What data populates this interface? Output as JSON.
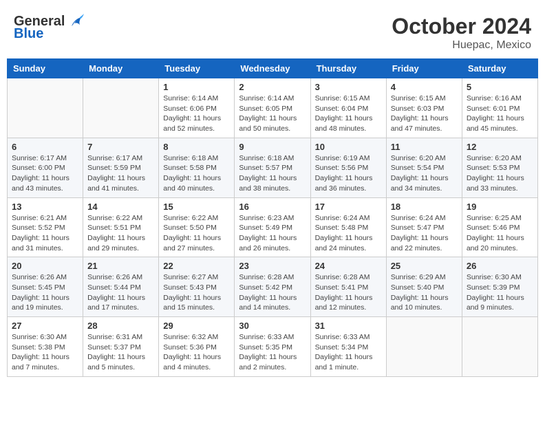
{
  "header": {
    "logo_general": "General",
    "logo_blue": "Blue",
    "month_title": "October 2024",
    "location": "Huepac, Mexico"
  },
  "days_of_week": [
    "Sunday",
    "Monday",
    "Tuesday",
    "Wednesday",
    "Thursday",
    "Friday",
    "Saturday"
  ],
  "weeks": [
    [
      {
        "day": "",
        "info": ""
      },
      {
        "day": "",
        "info": ""
      },
      {
        "day": "1",
        "info": "Sunrise: 6:14 AM\nSunset: 6:06 PM\nDaylight: 11 hours and 52 minutes."
      },
      {
        "day": "2",
        "info": "Sunrise: 6:14 AM\nSunset: 6:05 PM\nDaylight: 11 hours and 50 minutes."
      },
      {
        "day": "3",
        "info": "Sunrise: 6:15 AM\nSunset: 6:04 PM\nDaylight: 11 hours and 48 minutes."
      },
      {
        "day": "4",
        "info": "Sunrise: 6:15 AM\nSunset: 6:03 PM\nDaylight: 11 hours and 47 minutes."
      },
      {
        "day": "5",
        "info": "Sunrise: 6:16 AM\nSunset: 6:01 PM\nDaylight: 11 hours and 45 minutes."
      }
    ],
    [
      {
        "day": "6",
        "info": "Sunrise: 6:17 AM\nSunset: 6:00 PM\nDaylight: 11 hours and 43 minutes."
      },
      {
        "day": "7",
        "info": "Sunrise: 6:17 AM\nSunset: 5:59 PM\nDaylight: 11 hours and 41 minutes."
      },
      {
        "day": "8",
        "info": "Sunrise: 6:18 AM\nSunset: 5:58 PM\nDaylight: 11 hours and 40 minutes."
      },
      {
        "day": "9",
        "info": "Sunrise: 6:18 AM\nSunset: 5:57 PM\nDaylight: 11 hours and 38 minutes."
      },
      {
        "day": "10",
        "info": "Sunrise: 6:19 AM\nSunset: 5:56 PM\nDaylight: 11 hours and 36 minutes."
      },
      {
        "day": "11",
        "info": "Sunrise: 6:20 AM\nSunset: 5:54 PM\nDaylight: 11 hours and 34 minutes."
      },
      {
        "day": "12",
        "info": "Sunrise: 6:20 AM\nSunset: 5:53 PM\nDaylight: 11 hours and 33 minutes."
      }
    ],
    [
      {
        "day": "13",
        "info": "Sunrise: 6:21 AM\nSunset: 5:52 PM\nDaylight: 11 hours and 31 minutes."
      },
      {
        "day": "14",
        "info": "Sunrise: 6:22 AM\nSunset: 5:51 PM\nDaylight: 11 hours and 29 minutes."
      },
      {
        "day": "15",
        "info": "Sunrise: 6:22 AM\nSunset: 5:50 PM\nDaylight: 11 hours and 27 minutes."
      },
      {
        "day": "16",
        "info": "Sunrise: 6:23 AM\nSunset: 5:49 PM\nDaylight: 11 hours and 26 minutes."
      },
      {
        "day": "17",
        "info": "Sunrise: 6:24 AM\nSunset: 5:48 PM\nDaylight: 11 hours and 24 minutes."
      },
      {
        "day": "18",
        "info": "Sunrise: 6:24 AM\nSunset: 5:47 PM\nDaylight: 11 hours and 22 minutes."
      },
      {
        "day": "19",
        "info": "Sunrise: 6:25 AM\nSunset: 5:46 PM\nDaylight: 11 hours and 20 minutes."
      }
    ],
    [
      {
        "day": "20",
        "info": "Sunrise: 6:26 AM\nSunset: 5:45 PM\nDaylight: 11 hours and 19 minutes."
      },
      {
        "day": "21",
        "info": "Sunrise: 6:26 AM\nSunset: 5:44 PM\nDaylight: 11 hours and 17 minutes."
      },
      {
        "day": "22",
        "info": "Sunrise: 6:27 AM\nSunset: 5:43 PM\nDaylight: 11 hours and 15 minutes."
      },
      {
        "day": "23",
        "info": "Sunrise: 6:28 AM\nSunset: 5:42 PM\nDaylight: 11 hours and 14 minutes."
      },
      {
        "day": "24",
        "info": "Sunrise: 6:28 AM\nSunset: 5:41 PM\nDaylight: 11 hours and 12 minutes."
      },
      {
        "day": "25",
        "info": "Sunrise: 6:29 AM\nSunset: 5:40 PM\nDaylight: 11 hours and 10 minutes."
      },
      {
        "day": "26",
        "info": "Sunrise: 6:30 AM\nSunset: 5:39 PM\nDaylight: 11 hours and 9 minutes."
      }
    ],
    [
      {
        "day": "27",
        "info": "Sunrise: 6:30 AM\nSunset: 5:38 PM\nDaylight: 11 hours and 7 minutes."
      },
      {
        "day": "28",
        "info": "Sunrise: 6:31 AM\nSunset: 5:37 PM\nDaylight: 11 hours and 5 minutes."
      },
      {
        "day": "29",
        "info": "Sunrise: 6:32 AM\nSunset: 5:36 PM\nDaylight: 11 hours and 4 minutes."
      },
      {
        "day": "30",
        "info": "Sunrise: 6:33 AM\nSunset: 5:35 PM\nDaylight: 11 hours and 2 minutes."
      },
      {
        "day": "31",
        "info": "Sunrise: 6:33 AM\nSunset: 5:34 PM\nDaylight: 11 hours and 1 minute."
      },
      {
        "day": "",
        "info": ""
      },
      {
        "day": "",
        "info": ""
      }
    ]
  ]
}
